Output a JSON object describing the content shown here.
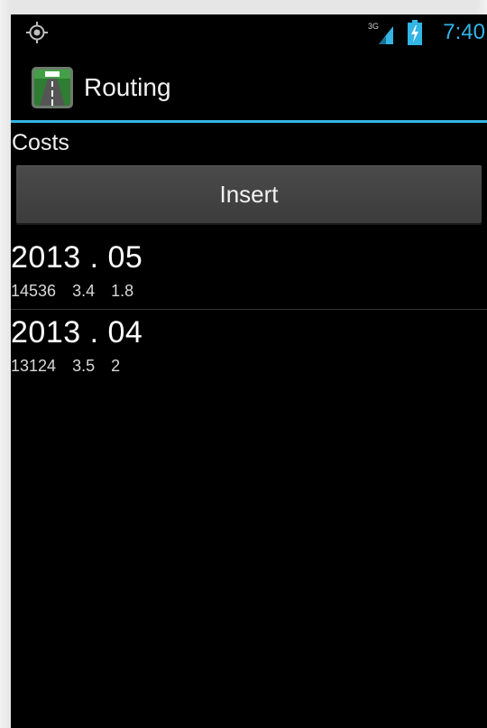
{
  "status_bar": {
    "network_label": "3G",
    "time": "7:40",
    "icons": {
      "location": "gps-icon",
      "signal": "signal-icon",
      "battery": "battery-charging-icon"
    },
    "accent_color": "#33b5e5"
  },
  "action_bar": {
    "title": "Routing",
    "icon": "routing-app-icon"
  },
  "content": {
    "section_label": "Costs",
    "insert_button_label": "Insert",
    "items": [
      {
        "title": "2013 . 05",
        "values": [
          "14536",
          "3.4",
          "1.8"
        ]
      },
      {
        "title": "2013 . 04",
        "values": [
          "13124",
          "3.5",
          "2"
        ]
      }
    ]
  }
}
